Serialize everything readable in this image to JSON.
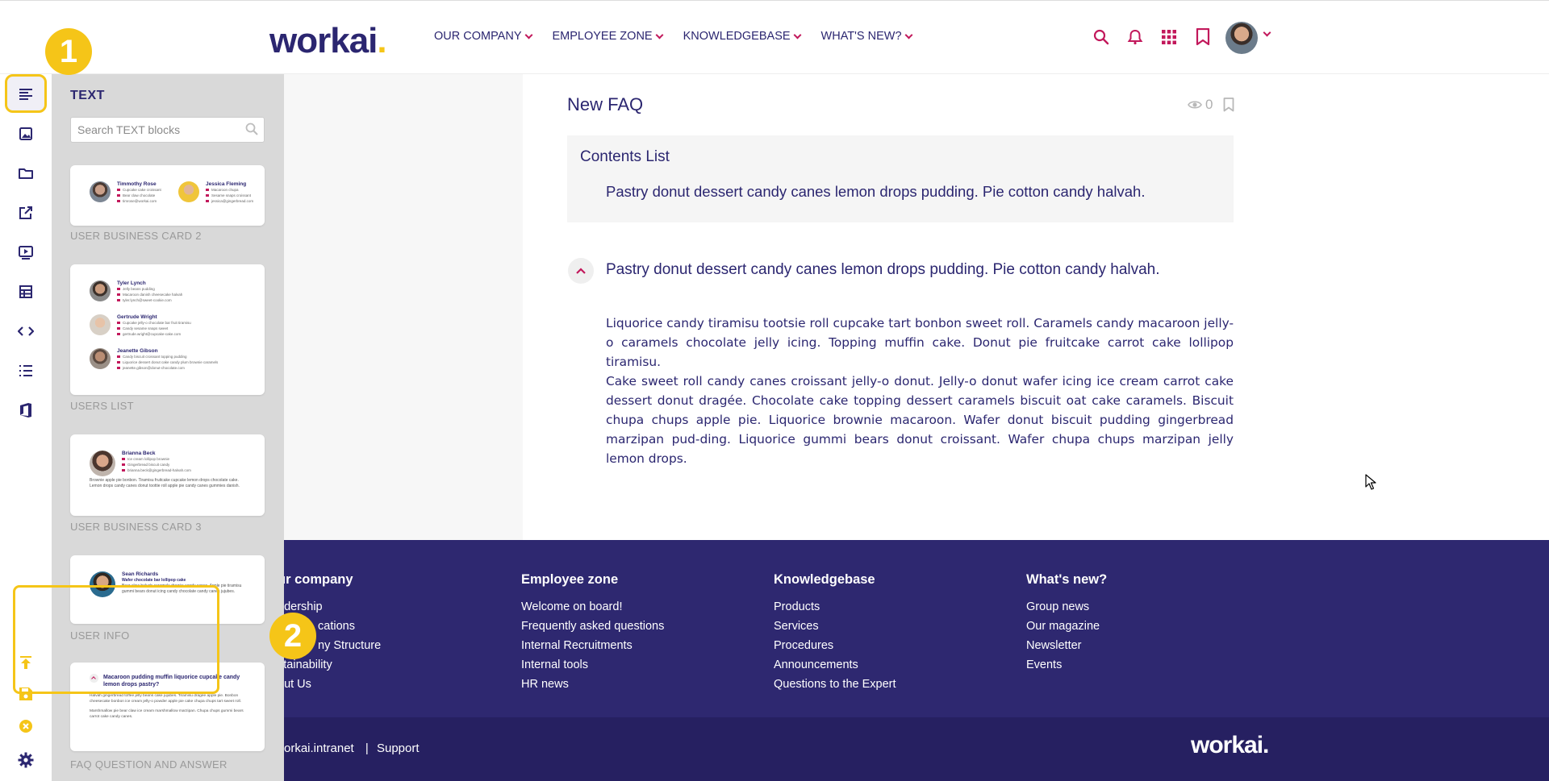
{
  "header": {
    "logo": "workai",
    "logo_dot": ".",
    "nav": [
      {
        "label": "OUR COMPANY"
      },
      {
        "label": "EMPLOYEE ZONE"
      },
      {
        "label": "KNOWLEDGEBASE"
      },
      {
        "label": "WHAT'S NEW?"
      }
    ],
    "icons": [
      "search-icon",
      "bell-icon",
      "apps-grid-icon",
      "bookmark-icon"
    ],
    "accent_color": "#c2185b"
  },
  "sidebar": {
    "icons": [
      "text-block-icon",
      "image-icon",
      "folder-icon",
      "external-link-icon",
      "video-icon",
      "table-icon",
      "code-icon",
      "list-icon",
      "office-icon",
      "upload-icon",
      "save-icon",
      "close-icon",
      "settings-icon"
    ]
  },
  "badges": {
    "one": "1",
    "two": "2"
  },
  "panel": {
    "title": "TEXT",
    "search_placeholder": "Search TEXT blocks",
    "cards": [
      {
        "label": "USER BUSINESS CARD 2",
        "people": [
          {
            "name": "Timmothy Rose",
            "lines": [
              "Cupcake cake croissant",
              "Bear claw chocolate",
              "timrose@workai.com"
            ]
          },
          {
            "name": "Jessica Fleming",
            "lines": [
              "Macaroon chupa",
              "Sesame snaps croissant",
              "jessica@gingerbread.com"
            ]
          }
        ]
      },
      {
        "label": "USERS LIST",
        "people": [
          {
            "name": "Tyler Lynch",
            "lines": [
              "Jelly beans pudding",
              "Macaroon danish cheesecake halvah",
              "tyler.lynch@sweet-cookie.com"
            ]
          },
          {
            "name": "Gertrude Wright",
            "lines": [
              "Cupcake jelly-o chocolate bar fruit tiramisu",
              "Candy sesame snaps sweet",
              "gertrude.wright@cupcake-cake.com"
            ]
          },
          {
            "name": "Jeanette Gibson",
            "lines": [
              "Candy biscuit croissant topping pudding",
              "Liquorice dessert donut cake candy plum brownie caramels",
              "jeanette.gibson@donut-chocolate.com"
            ]
          }
        ]
      },
      {
        "label": "USER BUSINESS CARD 3",
        "people": [
          {
            "name": "Brianna Beck",
            "lines": [
              "Ice cream lollipop brownie",
              "Gingerbread biscuit candy",
              "brianna.beck@gingerbread-halvah.com"
            ]
          }
        ],
        "body": "Brownie apple pie bonbon. Tiramisu fruitcake cupcake lemon drops chocolate cake. Lemon drops candy canes donut toottie roll apple pie candy canes gummies danish."
      },
      {
        "label": "USER INFO",
        "people": [
          {
            "name": "Sean Richards",
            "lines": [
              "Wafer chocolate bar lollipop cake"
            ]
          }
        ],
        "body": "Bear claw halvah caramels dragée candy canes. Apple pie tiramisu gummi bears donut icing candy chocolate candy canes jujubes."
      },
      {
        "label": "FAQ QUESTION AND ANSWER",
        "question": "Macaroon pudding muffin liquorice cupcake candy lemon drops pastry?",
        "body1": "Halvah gingerbread toffee jelly beans cake jujubes. Tiramisu dragée apple pie. Bonbon cheesecake bonbon ice cream jelly-o powder apple pie cake chupa chups tart sweet roll.",
        "body2": "Marshmallow pie bear claw ice cream marshmallow marzipan. Chupa chups gummi bears carrot cake candy canes."
      }
    ]
  },
  "article": {
    "title": "New FAQ",
    "views": "0",
    "contents_title": "Contents List",
    "contents_items": [
      "Pastry donut dessert candy canes lemon drops pudding. Pie cotton candy halvah."
    ],
    "question": "Pastry donut dessert candy canes lemon drops pudding. Pie cotton candy halvah.",
    "answer_1": "Liquorice candy tiramisu tootsie roll cupcake tart bonbon sweet roll. Caramels candy macaroon jelly-o caramels chocolate jelly icing. Topping muffin cake. Donut pie fruitcake carrot cake lollipop tiramisu.",
    "answer_2": "Cake sweet roll candy canes croissant jelly-o donut. Jelly-o donut wafer icing ice cream carrot cake dessert donut dragée. Chocolate cake topping dessert caramels biscuit oat cake caramels. Biscuit chupa chups apple pie. Liquorice brownie macaroon. Wafer donut biscuit pudding gingerbread marzipan pud-ding. Liquorice gummi bears donut croissant. Wafer chupa chups marzipan jelly lemon drops."
  },
  "footer": {
    "columns": [
      {
        "title": "ur company",
        "links": [
          "adership",
          "cations",
          "ny Structure",
          "stainability",
          "out Us"
        ]
      },
      {
        "title": "Employee zone",
        "links": [
          "Welcome on board!",
          "Frequently asked questions",
          "Internal Recruitments",
          "Internal tools",
          "HR news"
        ]
      },
      {
        "title": "Knowledgebase",
        "links": [
          "Products",
          "Services",
          "Procedures",
          "Announcements",
          "Questions to the Expert"
        ]
      },
      {
        "title": "What's new?",
        "links": [
          "Group news",
          "Our magazine",
          "Newsletter",
          "Events"
        ]
      }
    ],
    "bottom_left": "orkai.intranet",
    "bottom_sep": "|",
    "bottom_support": "Support",
    "logo": "workai."
  }
}
